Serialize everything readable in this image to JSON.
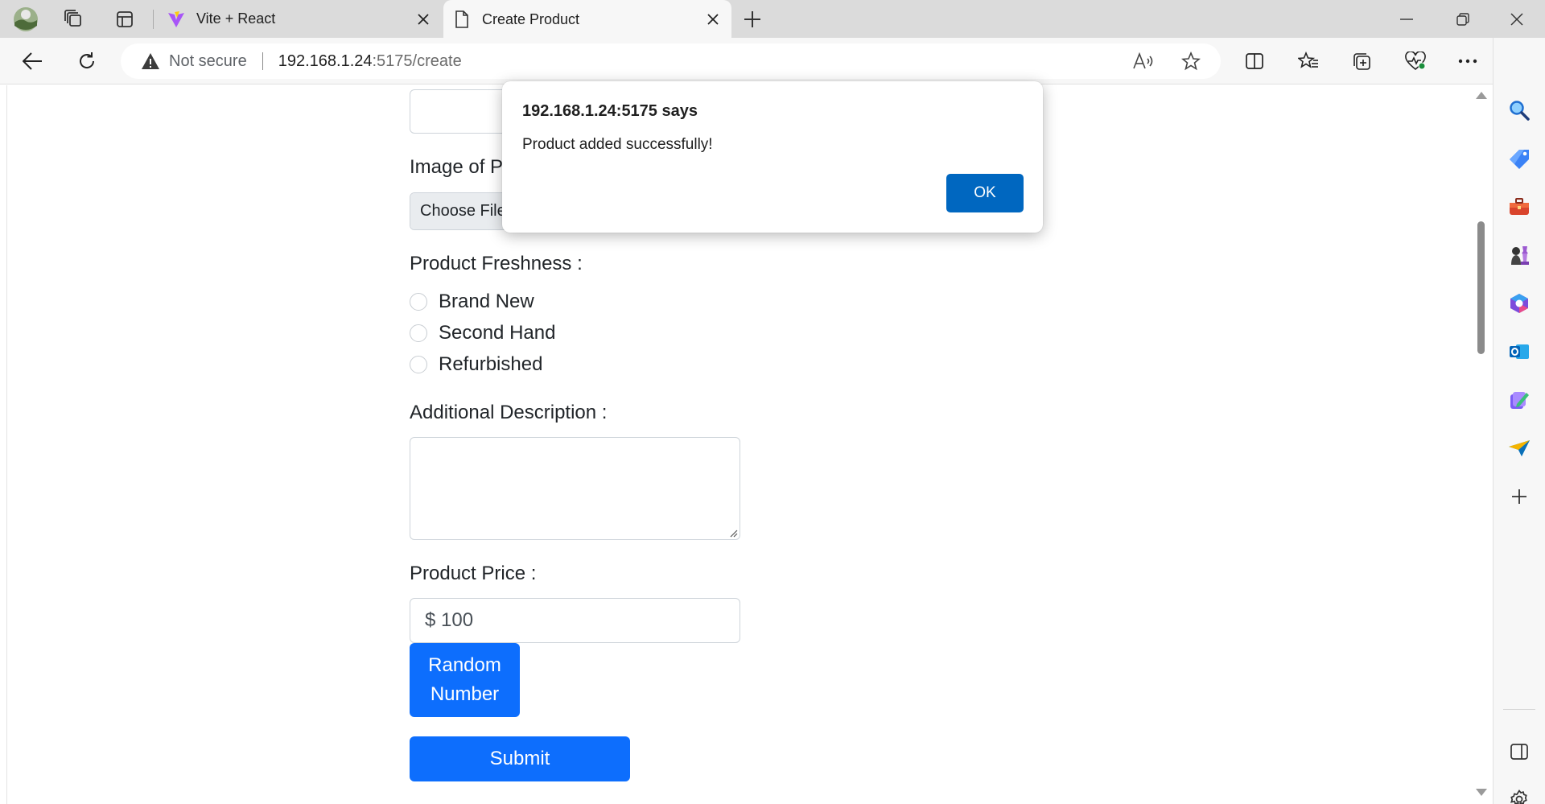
{
  "browser": {
    "tabs": [
      {
        "title": "Vite + React",
        "active": false,
        "favicon": "vite-logo-icon"
      },
      {
        "title": "Create Product",
        "active": true,
        "favicon": "page-icon"
      }
    ],
    "address": {
      "security_label": "Not secure",
      "host": "192.168.1.24",
      "path": ":5175/create"
    }
  },
  "form": {
    "image_label": "Image of P",
    "file_button": "Choose File",
    "freshness_label": "Product Freshness :",
    "freshness_options": [
      "Brand New",
      "Second Hand",
      "Refurbished"
    ],
    "description_label": "Additional Description :",
    "description_value": "",
    "price_label": "Product Price :",
    "price_value": "$ 100",
    "random_button_line1": "Random",
    "random_button_line2": "Number",
    "submit_button": "Submit"
  },
  "dialog": {
    "title": "192.168.1.24:5175 says",
    "message": "Product added successfully!",
    "ok_button": "OK"
  },
  "colors": {
    "primary": "#0d6efd",
    "dialog_ok": "#0067c0",
    "tabstrip": "#dbdbdb"
  }
}
